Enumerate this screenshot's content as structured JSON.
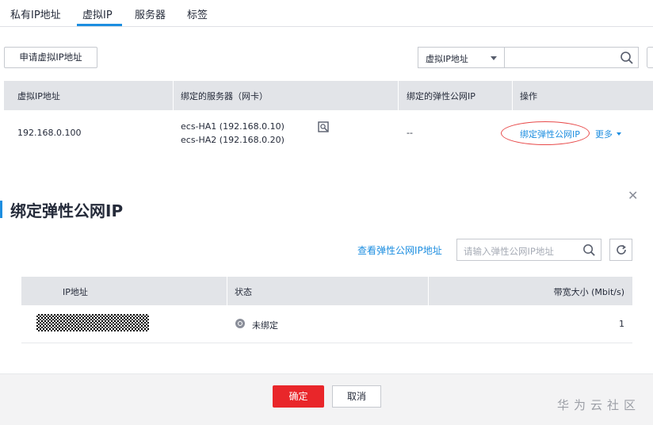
{
  "tabs": [
    {
      "label": "私有IP地址"
    },
    {
      "label": "虚拟IP"
    },
    {
      "label": "服务器"
    },
    {
      "label": "标签"
    }
  ],
  "toolbar": {
    "apply_button": "申请虚拟IP地址",
    "filter_select": "虚拟IP地址"
  },
  "vip_table": {
    "headers": [
      "虚拟IP地址",
      "绑定的服务器（网卡）",
      "绑定的弹性公网IP",
      "操作"
    ],
    "row": {
      "ip": "192.168.0.100",
      "servers": [
        "ecs-HA1 (192.168.0.10)",
        "ecs-HA2 (192.168.0.20)"
      ],
      "eip": "--",
      "action_bind": "绑定弹性公网IP",
      "action_more": "更多"
    }
  },
  "dialog": {
    "title": "绑定弹性公网IP",
    "view_link": "查看弹性公网IP地址",
    "search_placeholder": "请输入弹性公网IP地址",
    "headers": [
      "IP地址",
      "状态",
      "带宽大小 (Mbit/s)"
    ],
    "row": {
      "status": "未绑定",
      "bandwidth": "1"
    },
    "ok_button": "确定",
    "cancel_button": "取消"
  },
  "watermark": "华为云社区",
  "colors": {
    "accent": "#1d8ee0",
    "danger": "#e9262a",
    "header_bg": "#e2e4e8"
  }
}
